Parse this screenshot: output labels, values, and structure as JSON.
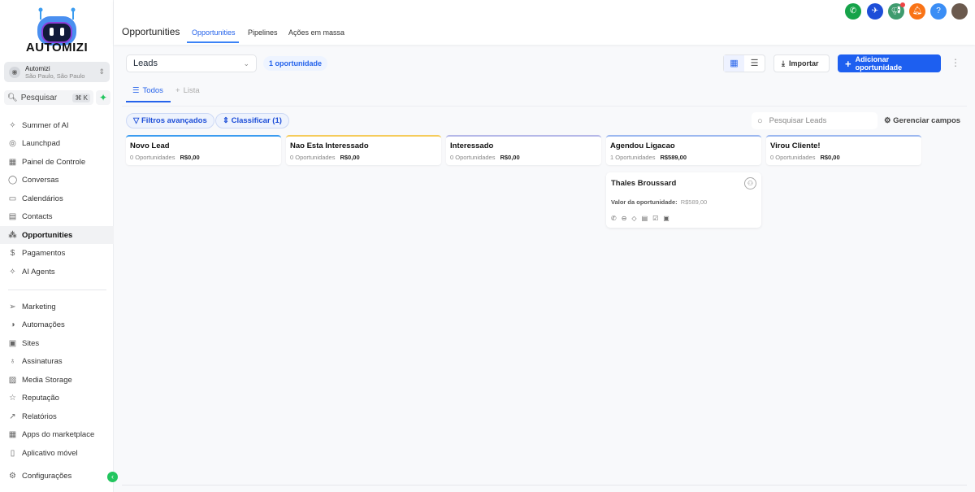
{
  "brand": {
    "name": "AUTOMIZI"
  },
  "account": {
    "name": "Automizi",
    "location": "São Paulo, São Paulo"
  },
  "search": {
    "label": "Pesquisar",
    "shortcut": "⌘ K"
  },
  "sidebar": {
    "items": [
      {
        "label": "Summer of AI",
        "icon": "✧"
      },
      {
        "label": "Launchpad",
        "icon": "◎"
      },
      {
        "label": "Painel de Controle",
        "icon": "▦"
      },
      {
        "label": "Conversas",
        "icon": "◯"
      },
      {
        "label": "Calendários",
        "icon": "▭"
      },
      {
        "label": "Contacts",
        "icon": "▤"
      },
      {
        "label": "Opportunities",
        "icon": "⁂"
      },
      {
        "label": "Pagamentos",
        "icon": "$"
      },
      {
        "label": "AI Agents",
        "icon": "✧"
      }
    ],
    "items2": [
      {
        "label": "Marketing",
        "icon": "➢"
      },
      {
        "label": "Automações",
        "icon": "◑"
      },
      {
        "label": "Sites",
        "icon": "▣"
      },
      {
        "label": "Assinaturas",
        "icon": "♁"
      },
      {
        "label": "Media Storage",
        "icon": "▨"
      },
      {
        "label": "Reputação",
        "icon": "☆"
      },
      {
        "label": "Relatórios",
        "icon": "↗"
      },
      {
        "label": "Apps do marketplace",
        "icon": "▦"
      },
      {
        "label": "Aplicativo móvel",
        "icon": "▯"
      }
    ],
    "settings": "Configurações"
  },
  "header": {
    "title": "Opportunities",
    "tabs": [
      "Opportunities",
      "Pipelines",
      "Ações em massa"
    ]
  },
  "toolbar": {
    "pipeline": "Leads",
    "count": "1 oportunidade",
    "import": "Importar",
    "add": "Adicionar oportunidade"
  },
  "views": {
    "all": "Todos",
    "list": "Lista"
  },
  "filters": {
    "advanced": "Filtros avançados",
    "sort": "Classificar (1)",
    "search_placeholder": "Pesquisar Leads",
    "manage": "Gerenciar campos"
  },
  "colors": {
    "accent": "#1d5ff0"
  },
  "stages": [
    {
      "name": "Novo Lead",
      "count": "0 Oportunidades",
      "value": "R$0,00",
      "color": "#3b9cf0"
    },
    {
      "name": "Nao Esta Interessado",
      "count": "0 Oportunidades",
      "value": "R$0,00",
      "color": "#f5cc5c"
    },
    {
      "name": "Interessado",
      "count": "0 Oportunidades",
      "value": "R$0,00",
      "color": "#b5b8e8"
    },
    {
      "name": "Agendou Ligacao",
      "count": "1 Oportunidades",
      "value": "R$589,00",
      "color": "#9cb8f0"
    },
    {
      "name": "Virou Cliente!",
      "count": "0 Oportunidades",
      "value": "R$0,00",
      "color": "#9cb8f0"
    }
  ],
  "card": {
    "name": "Thales Broussard",
    "value_label": "Valor da oportunidade:",
    "value": "R$589,00"
  }
}
